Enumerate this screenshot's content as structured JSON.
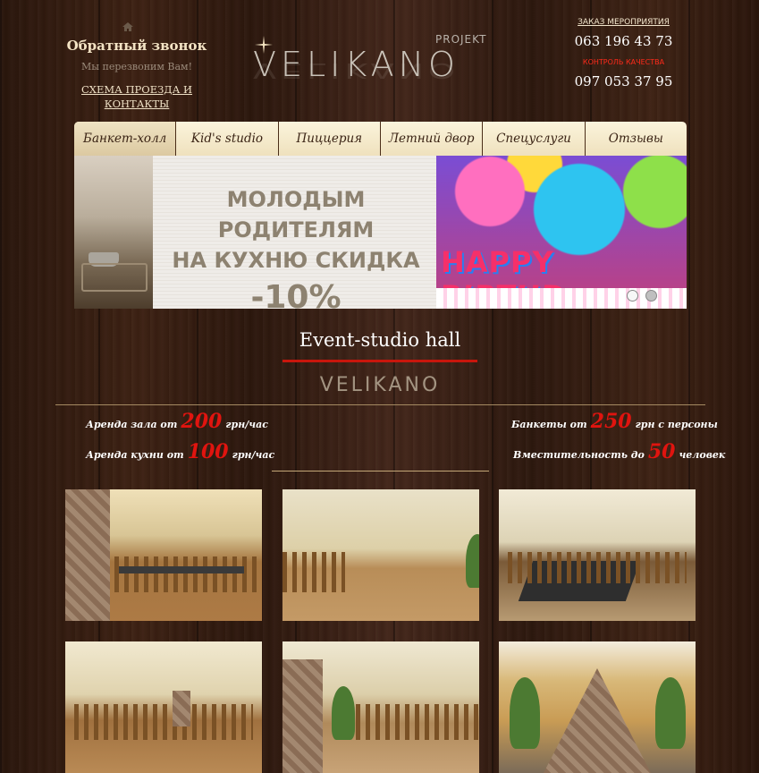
{
  "header": {
    "callback_title": "Обратный звонок",
    "callback_subtitle": "Мы перезвоним Вам!",
    "map_link": "СХЕМА ПРОЕЗДА И КОНТАКТЫ",
    "logo_projekt": "PROJEKT",
    "logo_name": "VELIKANO",
    "order_label": "ЗАКАЗ МЕРОПРИЯТИЯ",
    "order_phone": "063 196 43 73",
    "quality_label": "КОНТРОЛЬ КАЧЕСТВА",
    "quality_phone": "097 053 37 95"
  },
  "nav": {
    "items": [
      {
        "label": "Банкет-холл",
        "active": true
      },
      {
        "label": "Kid's studio"
      },
      {
        "label": "Пиццерия"
      },
      {
        "label": "Летний двор"
      },
      {
        "label": "Спецуслуги"
      },
      {
        "label": "Отзывы"
      }
    ]
  },
  "banner": {
    "line1": "МОЛОДЫМ РОДИТЕЛЯМ",
    "line2": "НА КУХНЮ СКИДКА",
    "line3": "-10%",
    "birthday_text": "HAPPY BIRTHD",
    "slides_count": 2,
    "active_slide": 1
  },
  "main": {
    "title": "Event-studio hall",
    "sub_logo": "VELIKANO",
    "info": [
      {
        "prefix": "Аренда зала от",
        "number": "200",
        "suffix": "грн/час"
      },
      {
        "prefix": "Аренда кухни от",
        "number": "100",
        "suffix": "грн/час"
      },
      {
        "prefix": "Банкеты от",
        "number": "250",
        "suffix": "грн с персоны"
      },
      {
        "prefix": "Вместительность до",
        "number": "50",
        "suffix": "человек"
      }
    ]
  },
  "colors": {
    "accent_red": "#e0140f",
    "nav_bg": "#fbf4dc",
    "wood_dark": "#2a160c"
  }
}
